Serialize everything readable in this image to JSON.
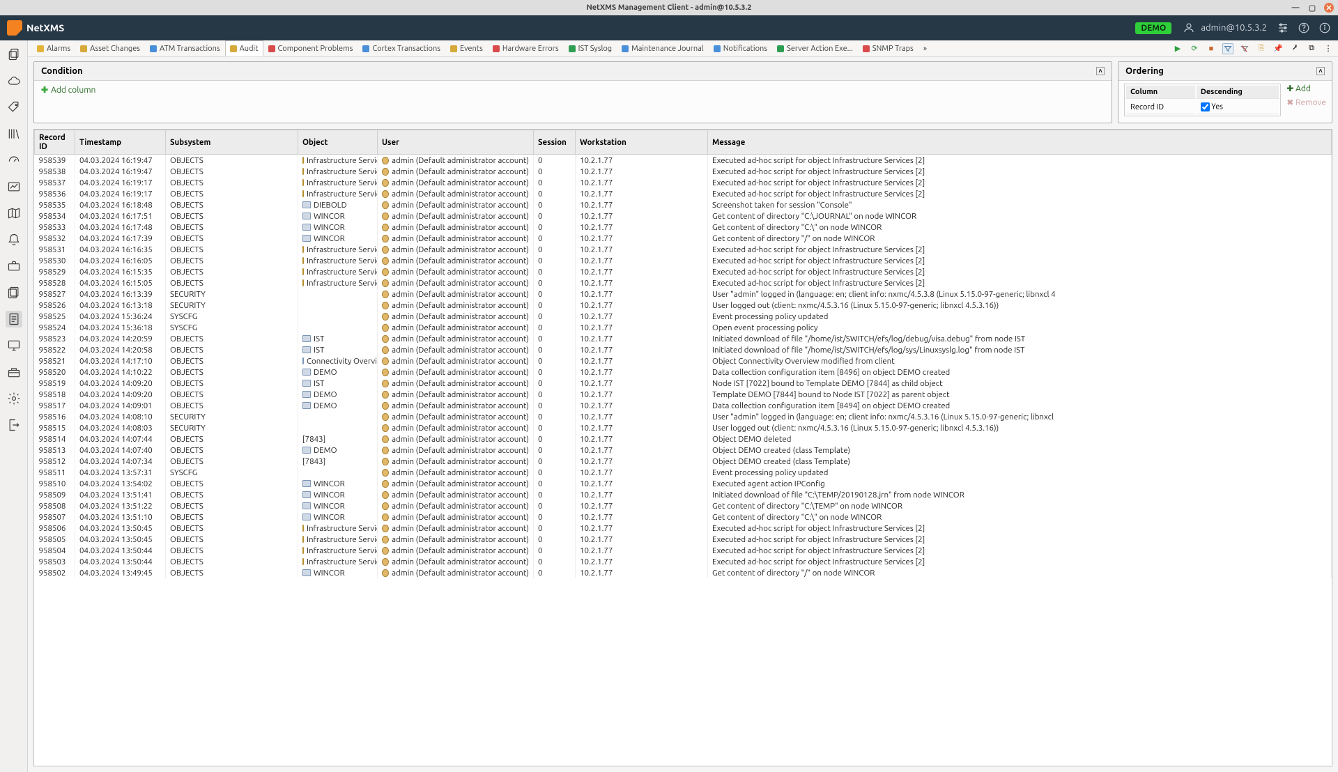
{
  "window": {
    "title": "NetXMS Management Client - admin@10.5.3.2"
  },
  "header": {
    "brand": "NetXMS",
    "demo": "DEMO",
    "user": "admin@10.5.3.2"
  },
  "tabs": [
    {
      "label": "Alarms",
      "color": "#e4b43a"
    },
    {
      "label": "Asset Changes",
      "color": "#d6a93a"
    },
    {
      "label": "ATM Transactions",
      "color": "#4a90d9"
    },
    {
      "label": "Audit",
      "color": "#d6a93a",
      "active": true
    },
    {
      "label": "Component Problems",
      "color": "#d94a4a"
    },
    {
      "label": "Cortex Transactions",
      "color": "#4a90d9"
    },
    {
      "label": "Events",
      "color": "#d6a93a"
    },
    {
      "label": "Hardware Errors",
      "color": "#d94a4a"
    },
    {
      "label": "IST Syslog",
      "color": "#2f9e54"
    },
    {
      "label": "Maintenance Journal",
      "color": "#4a90d9"
    },
    {
      "label": "Notifications",
      "color": "#4a90d9"
    },
    {
      "label": "Server Action Exe...",
      "color": "#2f9e54"
    },
    {
      "label": "SNMP Traps",
      "color": "#d94a4a"
    }
  ],
  "condition": {
    "title": "Condition",
    "add_label": "Add column"
  },
  "ordering": {
    "title": "Ordering",
    "cols": {
      "column": "Column",
      "descending": "Descending"
    },
    "row": {
      "column": "Record ID",
      "descending": "Yes",
      "checked": true
    },
    "add_label": "Add",
    "remove_label": "Remove"
  },
  "columns": [
    {
      "key": "record",
      "label": "Record ID"
    },
    {
      "key": "ts",
      "label": "Timestamp"
    },
    {
      "key": "sub",
      "label": "Subsystem"
    },
    {
      "key": "obj",
      "label": "Object"
    },
    {
      "key": "user",
      "label": "User"
    },
    {
      "key": "sess",
      "label": "Session"
    },
    {
      "key": "ws",
      "label": "Workstation"
    },
    {
      "key": "msg",
      "label": "Message"
    }
  ],
  "rows": [
    {
      "record": "958539",
      "ts": "04.03.2024 16:19:47",
      "sub": "OBJECTS",
      "obj": "Infrastructure Service",
      "objt": "folder",
      "user": "admin (Default administrator account)",
      "sess": "0",
      "ws": "10.2.1.77",
      "msg": "Executed ad-hoc script for object Infrastructure Services [2]"
    },
    {
      "record": "958538",
      "ts": "04.03.2024 16:19:47",
      "sub": "OBJECTS",
      "obj": "Infrastructure Service",
      "objt": "folder",
      "user": "admin (Default administrator account)",
      "sess": "0",
      "ws": "10.2.1.77",
      "msg": "Executed ad-hoc script for object Infrastructure Services [2]"
    },
    {
      "record": "958537",
      "ts": "04.03.2024 16:19:17",
      "sub": "OBJECTS",
      "obj": "Infrastructure Service",
      "objt": "folder",
      "user": "admin (Default administrator account)",
      "sess": "0",
      "ws": "10.2.1.77",
      "msg": "Executed ad-hoc script for object Infrastructure Services [2]"
    },
    {
      "record": "958536",
      "ts": "04.03.2024 16:19:17",
      "sub": "OBJECTS",
      "obj": "Infrastructure Service",
      "objt": "folder",
      "user": "admin (Default administrator account)",
      "sess": "0",
      "ws": "10.2.1.77",
      "msg": "Executed ad-hoc script for object Infrastructure Services [2]"
    },
    {
      "record": "958535",
      "ts": "04.03.2024 16:18:48",
      "sub": "OBJECTS",
      "obj": "DIEBOLD",
      "objt": "node",
      "user": "admin (Default administrator account)",
      "sess": "0",
      "ws": "10.2.1.77",
      "msg": "Screenshot taken for session \"Console\""
    },
    {
      "record": "958534",
      "ts": "04.03.2024 16:17:51",
      "sub": "OBJECTS",
      "obj": "WINCOR",
      "objt": "node",
      "user": "admin (Default administrator account)",
      "sess": "0",
      "ws": "10.2.1.77",
      "msg": "Get content of directory \"C:\\JOURNAL\" on node WINCOR"
    },
    {
      "record": "958533",
      "ts": "04.03.2024 16:17:48",
      "sub": "OBJECTS",
      "obj": "WINCOR",
      "objt": "node",
      "user": "admin (Default administrator account)",
      "sess": "0",
      "ws": "10.2.1.77",
      "msg": "Get content of directory \"C:\\\" on node WINCOR"
    },
    {
      "record": "958532",
      "ts": "04.03.2024 16:17:39",
      "sub": "OBJECTS",
      "obj": "WINCOR",
      "objt": "node",
      "user": "admin (Default administrator account)",
      "sess": "0",
      "ws": "10.2.1.77",
      "msg": "Get content of directory \"/\" on node WINCOR"
    },
    {
      "record": "958531",
      "ts": "04.03.2024 16:16:35",
      "sub": "OBJECTS",
      "obj": "Infrastructure Service",
      "objt": "folder",
      "user": "admin (Default administrator account)",
      "sess": "0",
      "ws": "10.2.1.77",
      "msg": "Executed ad-hoc script for object Infrastructure Services [2]"
    },
    {
      "record": "958530",
      "ts": "04.03.2024 16:16:05",
      "sub": "OBJECTS",
      "obj": "Infrastructure Service",
      "objt": "folder",
      "user": "admin (Default administrator account)",
      "sess": "0",
      "ws": "10.2.1.77",
      "msg": "Executed ad-hoc script for object Infrastructure Services [2]"
    },
    {
      "record": "958529",
      "ts": "04.03.2024 16:15:35",
      "sub": "OBJECTS",
      "obj": "Infrastructure Service",
      "objt": "folder",
      "user": "admin (Default administrator account)",
      "sess": "0",
      "ws": "10.2.1.77",
      "msg": "Executed ad-hoc script for object Infrastructure Services [2]"
    },
    {
      "record": "958528",
      "ts": "04.03.2024 16:15:05",
      "sub": "OBJECTS",
      "obj": "Infrastructure Service",
      "objt": "folder",
      "user": "admin (Default administrator account)",
      "sess": "0",
      "ws": "10.2.1.77",
      "msg": "Executed ad-hoc script for object Infrastructure Services [2]"
    },
    {
      "record": "958527",
      "ts": "04.03.2024 16:13:39",
      "sub": "SECURITY",
      "obj": "",
      "objt": "",
      "user": "admin (Default administrator account)",
      "sess": "0",
      "ws": "10.2.1.77",
      "msg": "User \"admin\" logged in (language: en; client info: nxmc/4.5.3.8 (Linux 5.15.0-97-generic; libnxcl 4"
    },
    {
      "record": "958526",
      "ts": "04.03.2024 16:13:18",
      "sub": "SECURITY",
      "obj": "",
      "objt": "",
      "user": "admin (Default administrator account)",
      "sess": "0",
      "ws": "10.2.1.77",
      "msg": "User logged out (client: nxmc/4.5.3.16 (Linux 5.15.0-97-generic; libnxcl 4.5.3.16))"
    },
    {
      "record": "958525",
      "ts": "04.03.2024 15:36:24",
      "sub": "SYSCFG",
      "obj": "",
      "objt": "",
      "user": "admin (Default administrator account)",
      "sess": "0",
      "ws": "10.2.1.77",
      "msg": "Event processing policy updated"
    },
    {
      "record": "958524",
      "ts": "04.03.2024 15:36:18",
      "sub": "SYSCFG",
      "obj": "",
      "objt": "",
      "user": "admin (Default administrator account)",
      "sess": "0",
      "ws": "10.2.1.77",
      "msg": "Open event processing policy"
    },
    {
      "record": "958523",
      "ts": "04.03.2024 14:20:59",
      "sub": "OBJECTS",
      "obj": "IST",
      "objt": "node",
      "user": "admin (Default administrator account)",
      "sess": "0",
      "ws": "10.2.1.77",
      "msg": "Initiated download of file \"/home/ist/SWITCH/efs/log/debug/visa.debug\" from node IST"
    },
    {
      "record": "958522",
      "ts": "04.03.2024 14:20:58",
      "sub": "OBJECTS",
      "obj": "IST",
      "objt": "node",
      "user": "admin (Default administrator account)",
      "sess": "0",
      "ws": "10.2.1.77",
      "msg": "Initiated download of file \"/home/ist/SWITCH/efs/log/sys/Linuxsyslg.log\" from node IST"
    },
    {
      "record": "958521",
      "ts": "04.03.2024 14:17:10",
      "sub": "OBJECTS",
      "obj": "Connectivity Overview",
      "objt": "node",
      "user": "admin (Default administrator account)",
      "sess": "0",
      "ws": "10.2.1.77",
      "msg": "Object Connectivity Overview modified from client"
    },
    {
      "record": "958520",
      "ts": "04.03.2024 14:10:22",
      "sub": "OBJECTS",
      "obj": "DEMO",
      "objt": "node",
      "user": "admin (Default administrator account)",
      "sess": "0",
      "ws": "10.2.1.77",
      "msg": "Data collection configuration item [8496] on object DEMO created"
    },
    {
      "record": "958519",
      "ts": "04.03.2024 14:09:20",
      "sub": "OBJECTS",
      "obj": "IST",
      "objt": "node",
      "user": "admin (Default administrator account)",
      "sess": "0",
      "ws": "10.2.1.77",
      "msg": "Node IST [7022] bound to Template DEMO [7844] as child object"
    },
    {
      "record": "958518",
      "ts": "04.03.2024 14:09:20",
      "sub": "OBJECTS",
      "obj": "DEMO",
      "objt": "node",
      "user": "admin (Default administrator account)",
      "sess": "0",
      "ws": "10.2.1.77",
      "msg": "Template DEMO [7844] bound to Node IST [7022] as parent object"
    },
    {
      "record": "958517",
      "ts": "04.03.2024 14:09:01",
      "sub": "OBJECTS",
      "obj": "DEMO",
      "objt": "node",
      "user": "admin (Default administrator account)",
      "sess": "0",
      "ws": "10.2.1.77",
      "msg": "Data collection configuration item [8494] on object DEMO created"
    },
    {
      "record": "958516",
      "ts": "04.03.2024 14:08:10",
      "sub": "SECURITY",
      "obj": "",
      "objt": "",
      "user": "admin (Default administrator account)",
      "sess": "0",
      "ws": "10.2.1.77",
      "msg": "User \"admin\" logged in (language: en; client info: nxmc/4.5.3.16 (Linux 5.15.0-97-generic; libnxcl"
    },
    {
      "record": "958515",
      "ts": "04.03.2024 14:08:03",
      "sub": "SECURITY",
      "obj": "",
      "objt": "",
      "user": "admin (Default administrator account)",
      "sess": "0",
      "ws": "10.2.1.77",
      "msg": "User logged out (client: nxmc/4.5.3.16 (Linux 5.15.0-97-generic; libnxcl 4.5.3.16))"
    },
    {
      "record": "958514",
      "ts": "04.03.2024 14:07:44",
      "sub": "OBJECTS",
      "obj": "[7843]",
      "objt": "",
      "user": "admin (Default administrator account)",
      "sess": "0",
      "ws": "10.2.1.77",
      "msg": "Object DEMO deleted"
    },
    {
      "record": "958513",
      "ts": "04.03.2024 14:07:40",
      "sub": "OBJECTS",
      "obj": "DEMO",
      "objt": "node",
      "user": "admin (Default administrator account)",
      "sess": "0",
      "ws": "10.2.1.77",
      "msg": "Object DEMO created (class Template)"
    },
    {
      "record": "958512",
      "ts": "04.03.2024 14:07:34",
      "sub": "OBJECTS",
      "obj": "[7843]",
      "objt": "",
      "user": "admin (Default administrator account)",
      "sess": "0",
      "ws": "10.2.1.77",
      "msg": "Object DEMO created (class Template)"
    },
    {
      "record": "958511",
      "ts": "04.03.2024 13:57:31",
      "sub": "SYSCFG",
      "obj": "",
      "objt": "",
      "user": "admin (Default administrator account)",
      "sess": "0",
      "ws": "10.2.1.77",
      "msg": "Event processing policy updated"
    },
    {
      "record": "958510",
      "ts": "04.03.2024 13:54:02",
      "sub": "OBJECTS",
      "obj": "WINCOR",
      "objt": "node",
      "user": "admin (Default administrator account)",
      "sess": "0",
      "ws": "10.2.1.77",
      "msg": "Executed agent action IPConfig"
    },
    {
      "record": "958509",
      "ts": "04.03.2024 13:51:41",
      "sub": "OBJECTS",
      "obj": "WINCOR",
      "objt": "node",
      "user": "admin (Default administrator account)",
      "sess": "0",
      "ws": "10.2.1.77",
      "msg": "Initiated download of file \"C:\\TEMP/20190128.jrn\" from node WINCOR"
    },
    {
      "record": "958508",
      "ts": "04.03.2024 13:51:22",
      "sub": "OBJECTS",
      "obj": "WINCOR",
      "objt": "node",
      "user": "admin (Default administrator account)",
      "sess": "0",
      "ws": "10.2.1.77",
      "msg": "Get content of directory \"C:\\TEMP\" on node WINCOR"
    },
    {
      "record": "958507",
      "ts": "04.03.2024 13:51:10",
      "sub": "OBJECTS",
      "obj": "WINCOR",
      "objt": "node",
      "user": "admin (Default administrator account)",
      "sess": "0",
      "ws": "10.2.1.77",
      "msg": "Get content of directory \"C:\\\" on node WINCOR"
    },
    {
      "record": "958506",
      "ts": "04.03.2024 13:50:45",
      "sub": "OBJECTS",
      "obj": "Infrastructure Service",
      "objt": "folder",
      "user": "admin (Default administrator account)",
      "sess": "0",
      "ws": "10.2.1.77",
      "msg": "Executed ad-hoc script for object Infrastructure Services [2]"
    },
    {
      "record": "958505",
      "ts": "04.03.2024 13:50:45",
      "sub": "OBJECTS",
      "obj": "Infrastructure Service",
      "objt": "folder",
      "user": "admin (Default administrator account)",
      "sess": "0",
      "ws": "10.2.1.77",
      "msg": "Executed ad-hoc script for object Infrastructure Services [2]"
    },
    {
      "record": "958504",
      "ts": "04.03.2024 13:50:44",
      "sub": "OBJECTS",
      "obj": "Infrastructure Service",
      "objt": "folder",
      "user": "admin (Default administrator account)",
      "sess": "0",
      "ws": "10.2.1.77",
      "msg": "Executed ad-hoc script for object Infrastructure Services [2]"
    },
    {
      "record": "958503",
      "ts": "04.03.2024 13:50:44",
      "sub": "OBJECTS",
      "obj": "Infrastructure Service",
      "objt": "folder",
      "user": "admin (Default administrator account)",
      "sess": "0",
      "ws": "10.2.1.77",
      "msg": "Executed ad-hoc script for object Infrastructure Services [2]"
    },
    {
      "record": "958502",
      "ts": "04.03.2024 13:49:45",
      "sub": "OBJECTS",
      "obj": "WINCOR",
      "objt": "node",
      "user": "admin (Default administrator account)",
      "sess": "0",
      "ws": "10.2.1.77",
      "msg": "Get content of directory \"/\" on node WINCOR"
    }
  ]
}
